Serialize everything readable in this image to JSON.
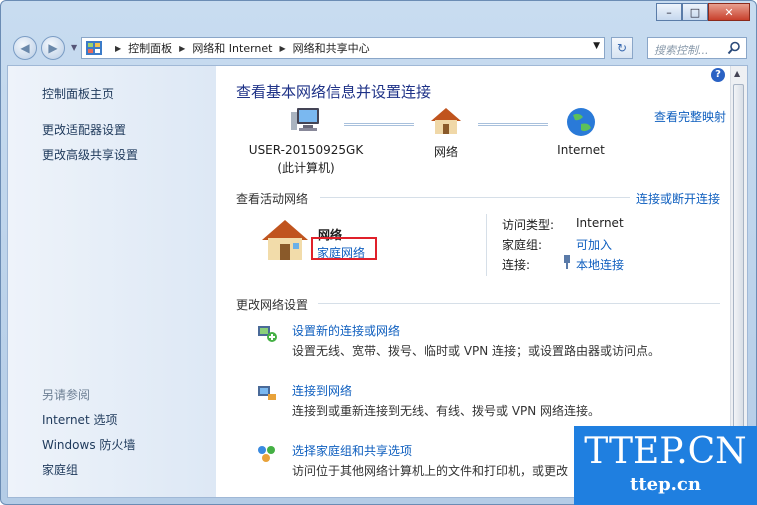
{
  "window": {
    "min": "–",
    "max": "□",
    "close": "✕"
  },
  "nav": {
    "back": "◀",
    "forward": "▶",
    "address": [
      "控制面板",
      "网络和 Internet",
      "网络和共享中心"
    ],
    "search_placeholder": "搜索控制..."
  },
  "sidebar": {
    "items": [
      "控制面板主页",
      "更改适配器设置",
      "更改高级共享设置"
    ],
    "see_also_heading": "另请参阅",
    "see_also": [
      "Internet 选项",
      "Windows 防火墙",
      "家庭组"
    ]
  },
  "main": {
    "title": "查看基本网络信息并设置连接",
    "map_link": "查看完整映射",
    "nodes": {
      "computer": "USER-20150925GK",
      "computer_sub": "(此计算机)",
      "network": "网络",
      "internet": "Internet"
    },
    "active_heading": "查看活动网络",
    "connect_link": "连接或断开连接",
    "active": {
      "name": "网络",
      "type": "家庭网络",
      "access_label": "访问类型:",
      "access_value": "Internet",
      "homegroup_label": "家庭组:",
      "homegroup_value": "可加入",
      "connection_label": "连接:",
      "connection_value": "本地连接"
    },
    "change_heading": "更改网络设置",
    "tasks": [
      {
        "link": "设置新的连接或网络",
        "desc": "设置无线、宽带、拨号、临时或 VPN 连接；或设置路由器或访问点。"
      },
      {
        "link": "连接到网络",
        "desc": "连接到或重新连接到无线、有线、拨号或 VPN 网络连接。"
      },
      {
        "link": "选择家庭组和共享选项",
        "desc": "访问位于其他网络计算机上的文件和打印机，或更改"
      }
    ]
  },
  "watermark": {
    "big": "TTEP.CN",
    "small": "ttep.cn"
  }
}
